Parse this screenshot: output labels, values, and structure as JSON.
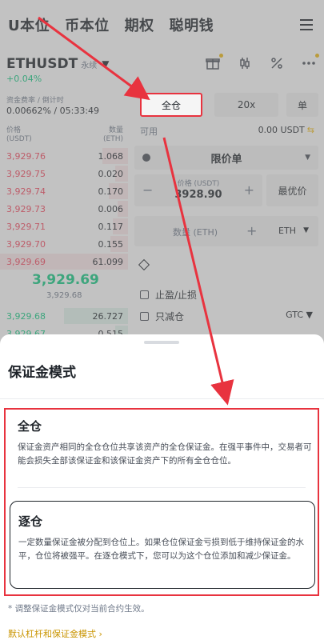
{
  "topnav": {
    "items": [
      "U本位",
      "币本位",
      "期权",
      "聪明钱"
    ]
  },
  "pair": {
    "symbol": "ETHUSDT",
    "tag": "永续",
    "change": "+0.04%"
  },
  "funding": {
    "label": "资金费率 / 倒计时",
    "value": "0.00662% / 05:33:49"
  },
  "controls": {
    "margin_mode": "全仓",
    "leverage": "20x",
    "position_mode": "单"
  },
  "orderbook": {
    "price_header": "价格\n(USDT)",
    "qty_header": "数量\n(ETH)",
    "asks": [
      {
        "price": "3,929.76",
        "qty": "1.068",
        "depth": 0.2
      },
      {
        "price": "3,929.75",
        "qty": "0.020",
        "depth": 0.1
      },
      {
        "price": "3,929.74",
        "qty": "0.170",
        "depth": 0.15
      },
      {
        "price": "3,929.73",
        "qty": "0.006",
        "depth": 0.08
      },
      {
        "price": "3,929.71",
        "qty": "0.117",
        "depth": 0.12
      },
      {
        "price": "3,929.70",
        "qty": "0.155",
        "depth": 0.14
      },
      {
        "price": "3,929.69",
        "qty": "61.099",
        "depth": 1.0
      }
    ],
    "last_price": "3,929.69",
    "mark_price": "3,929.68",
    "bids": [
      {
        "price": "3,929.68",
        "qty": "26.727",
        "depth": 0.5
      },
      {
        "price": "3,929.67",
        "qty": "0.515",
        "depth": 0.1
      }
    ]
  },
  "order_form": {
    "available_label": "可用",
    "available_value": "0.00 USDT",
    "order_type": "限价单",
    "price_label": "价格 (USDT)",
    "price_value": "3928.90",
    "best_price_button": "最优价",
    "qty_label": "数量 (ETH)",
    "qty_unit": "ETH",
    "tp_sl": "止盈/止损",
    "reduce_only": "只减仓",
    "tif": "GTC"
  },
  "sheet": {
    "title": "保证金模式",
    "cross": {
      "title": "全仓",
      "desc": "保证金资产相同的全仓仓位共享该资产的全仓保证金。在强平事件中，交易者可能会损失全部该保证金和该保证金资产下的所有全仓仓位。"
    },
    "isolated": {
      "title": "逐仓",
      "desc": "一定数量保证金被分配到仓位上。如果仓位保证金亏损到低于维持保证金的水平，仓位将被强平。在逐仓模式下，您可以为这个仓位添加和减少保证金。"
    },
    "note": "* 调整保证金模式仅对当前合约生效。",
    "link": "默认杠杆和保证金模式 ›"
  },
  "colors": {
    "accent_red": "#e8333f",
    "ask_red": "#f6465d",
    "bid_green": "#0ecb81",
    "brand_yellow": "#f0b90b"
  }
}
